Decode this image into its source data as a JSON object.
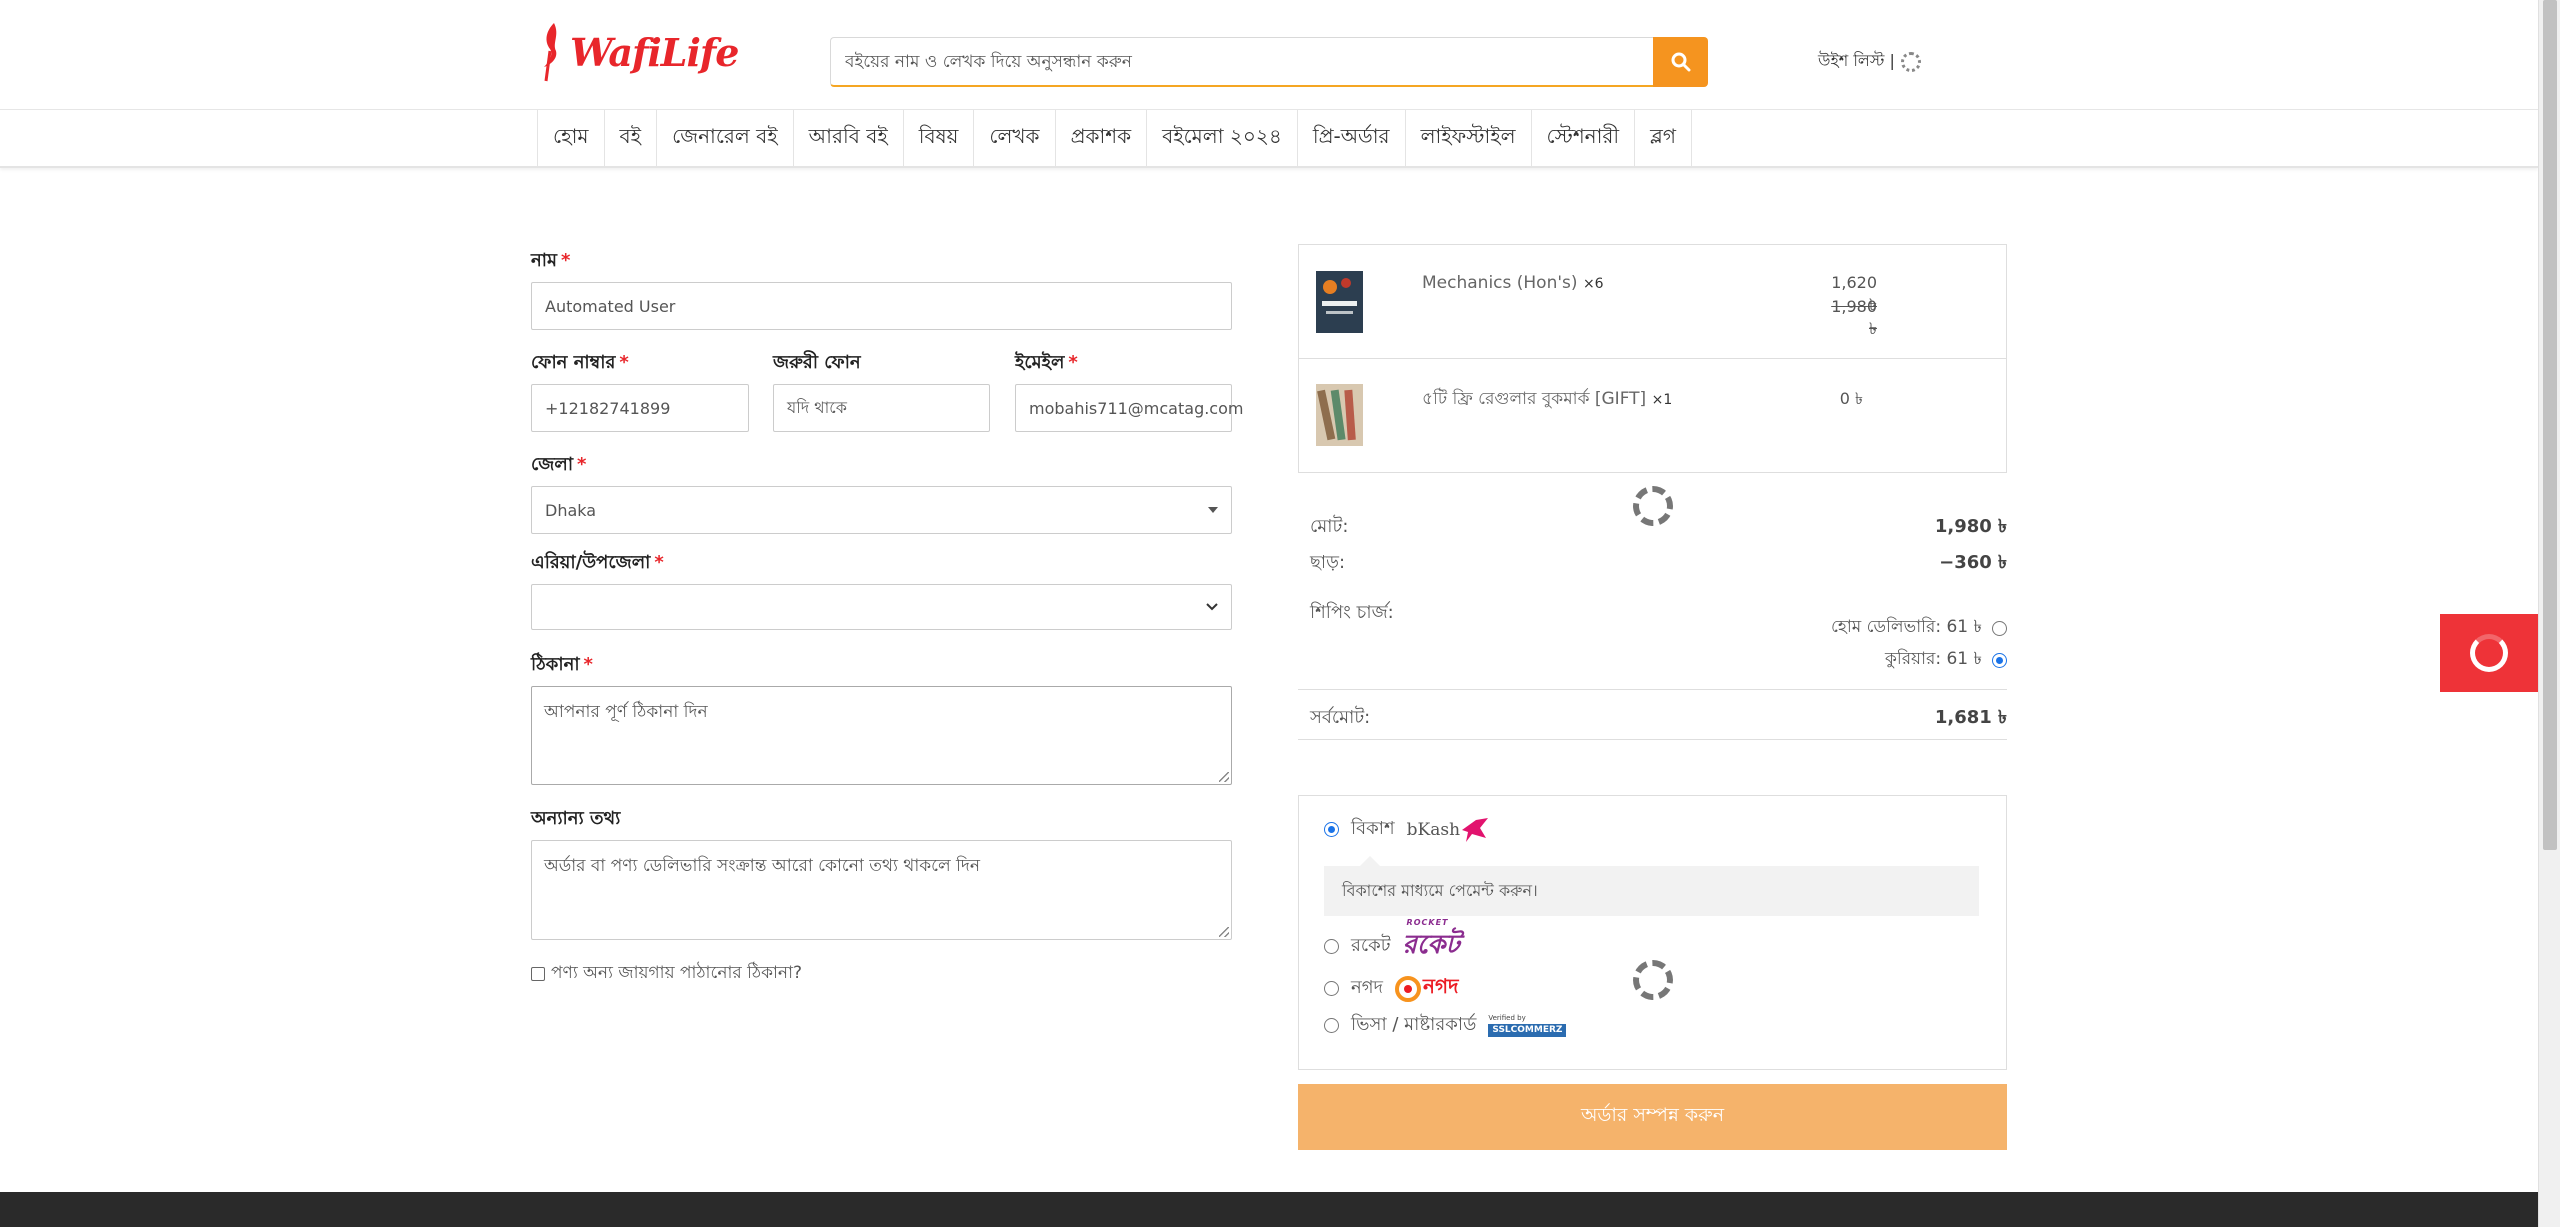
{
  "header": {
    "logo_text": "WafiLife",
    "search_placeholder": "বইয়ের নাম ও লেখক দিয়ে অনুসন্ধান করুন",
    "wishlist_label": "উইশ লিস্ট |"
  },
  "nav": {
    "items": [
      "হোম",
      "বই",
      "জেনারেল বই",
      "আরবি বই",
      "বিষয়",
      "লেখক",
      "প্রকাশক",
      "বইমেলা ২০২৪",
      "প্রি-অর্ডার",
      "লাইফস্টাইল",
      "স্টেশনারী",
      "ব্লগ"
    ]
  },
  "form": {
    "name_label": "নাম",
    "name_value": "Automated User",
    "phone_label": "ফোন নাম্বার",
    "phone_value": "+12182741899",
    "alt_phone_label": "জরুরী ফোন",
    "alt_phone_placeholder": "যদি থাকে",
    "email_label": "ইমেইল",
    "email_value": "mobahis711@mcatag.com",
    "district_label": "জেলা",
    "district_value": "Dhaka",
    "area_label": "এরিয়া/উপজেলা",
    "area_value": "",
    "address_label": "ঠিকানা",
    "address_placeholder": "আপনার পূর্ণ ঠিকানা দিন",
    "other_label": "অন্যান্য তথ্য",
    "other_placeholder": "অর্ডার বা পণ্য ডেলিভারি সংক্রান্ত আরো কোনো তথ্য থাকলে দিন",
    "ship_elsewhere_label": "পণ্য অন্য জায়গায় পাঠানোর ঠিকানা?",
    "required_mark": "*"
  },
  "cart": {
    "items": [
      {
        "name": "Mechanics (Hon's)",
        "qty": "×6",
        "price": "1,620 ৳",
        "old_price": "1,980 ৳"
      },
      {
        "name": "৫টি ফ্রি রেগুলার বুকমার্ক [GIFT]",
        "qty": "×1",
        "price": "0 ৳"
      }
    ]
  },
  "summary": {
    "total_label": "মোট:",
    "total_value": "1,980 ৳",
    "discount_label": "ছাড়:",
    "discount_value": "−360 ৳",
    "shipping_label": "শিপিং চার্জ:",
    "home_delivery": "হোম ডেলিভারি: 61 ৳",
    "courier": "কুরিয়ার: 61 ৳",
    "grand_label": "সর্বমোট:",
    "grand_value": "1,681 ৳"
  },
  "payment": {
    "bkash_label": "বিকাশ",
    "bkash_logo": "bKash",
    "bkash_note": "বিকাশের মাধ্যমে পেমেন্ট করুন।",
    "rocket_label": "রকেট",
    "rocket_logo_small": "ROCKET",
    "rocket_logo": "রকেট",
    "nagad_label": "নগদ",
    "nagad_logo": "নগদ",
    "card_label": "ভিসা / মাষ্টারকার্ড",
    "card_logo_small": "Verified by",
    "card_logo": "SSLCOMMERZ"
  },
  "order_button": "অর্ডার সম্পন্ন করুন",
  "colors": {
    "brand_red": "#e8262b",
    "accent_orange": "#f5941f",
    "button_disabled": "#f5b36b",
    "radio_blue": "#1a73e8"
  }
}
